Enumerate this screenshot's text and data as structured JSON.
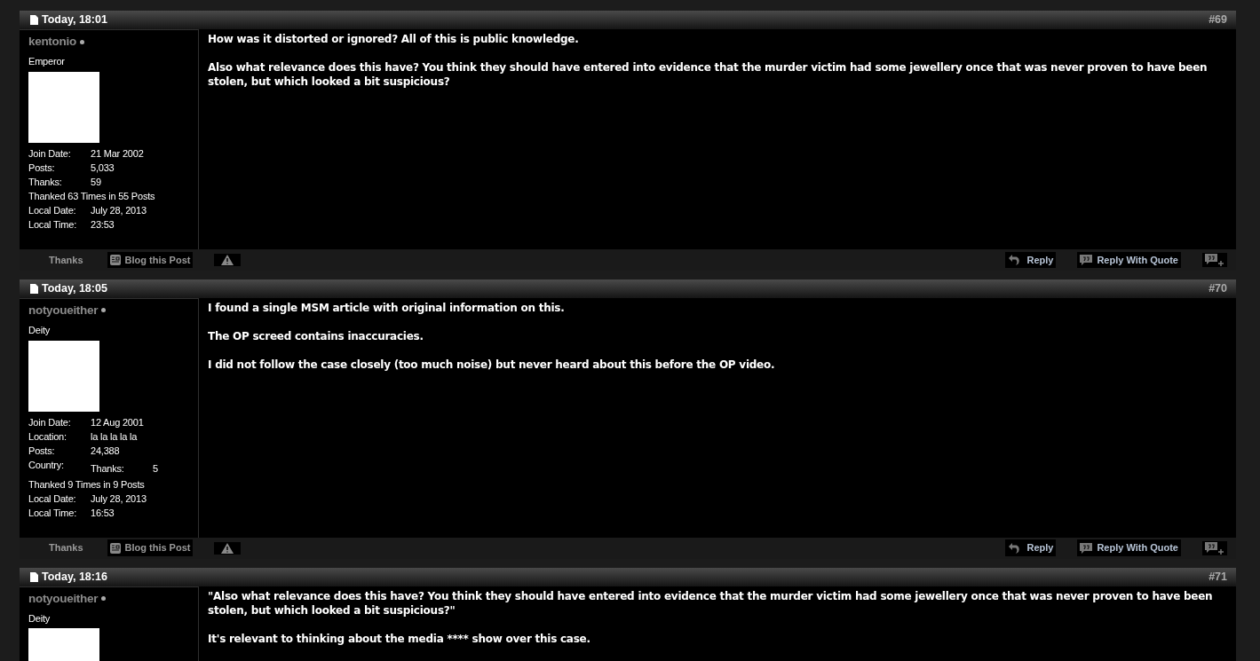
{
  "posts": [
    {
      "date": "Today, 18:01",
      "number": "#69",
      "user": {
        "name": "kentonio",
        "rank": "Emperor",
        "fields": [
          {
            "kind": "pair",
            "label": "Join Date:",
            "value": "21 Mar 2002"
          },
          {
            "kind": "pair",
            "label": "Posts:",
            "value": "5,033"
          },
          {
            "kind": "pair",
            "label": "Thanks:",
            "value": "59"
          },
          {
            "kind": "line",
            "label": "Thanked 63 Times in 55 Posts"
          },
          {
            "kind": "pair",
            "label": "Local Date:",
            "value": "July 28, 2013"
          },
          {
            "kind": "pair",
            "label": "Local Time:",
            "value": "23:53"
          }
        ]
      },
      "paragraphs": [
        "How was it distorted or ignored? All of this is public knowledge.",
        "Also what relevance does this have? You think they should have entered into evidence that the murder victim had some jewellery once that was never proven to have been stolen, but which looked a bit suspicious?"
      ],
      "actions": [
        {
          "kind": "thanks",
          "label": "Thanks"
        },
        {
          "kind": "blog",
          "label": "Blog this Post"
        },
        {
          "kind": "report"
        },
        {
          "kind": "reply",
          "label": "Reply"
        },
        {
          "kind": "quote",
          "label": "Reply With Quote"
        },
        {
          "kind": "multiquote"
        }
      ]
    },
    {
      "date": "Today, 18:05",
      "number": "#70",
      "user": {
        "name": "notyoueither",
        "rank": "Deity",
        "fields": [
          {
            "kind": "pair",
            "label": "Join Date:",
            "value": "12 Aug 2001"
          },
          {
            "kind": "pair",
            "label": "Location:",
            "value": "la la la la la"
          },
          {
            "kind": "pair",
            "label": "Posts:",
            "value": "24,388"
          },
          {
            "kind": "double",
            "label": "Country:",
            "sublabel": "Thanks:",
            "value": "5"
          },
          {
            "kind": "line",
            "label": "Thanked 9 Times in 9 Posts"
          },
          {
            "kind": "pair",
            "label": "Local Date:",
            "value": "July 28, 2013"
          },
          {
            "kind": "pair",
            "label": "Local Time:",
            "value": "16:53"
          }
        ]
      },
      "paragraphs": [
        "I found a single MSM article with original information on this.",
        "The OP screed contains inaccuracies.",
        "I did not follow the case closely (too much noise) but never heard about this before the OP video."
      ],
      "actions": [
        {
          "kind": "thanks",
          "label": "Thanks"
        },
        {
          "kind": "blog",
          "label": "Blog this Post"
        },
        {
          "kind": "report"
        },
        {
          "kind": "reply",
          "label": "Reply"
        },
        {
          "kind": "quote",
          "label": "Reply With Quote"
        },
        {
          "kind": "multiquote"
        }
      ]
    },
    {
      "date": "Today, 18:16",
      "number": "#71",
      "user": {
        "name": "notyoueither",
        "rank": "Deity"
      },
      "paragraphs": [
        "\"Also what relevance does this have? You think they should have entered into evidence that the murder victim had some jewellery once that was never proven to have been stolen, but which looked a bit suspicious?\"",
        "It's relevant to thinking about the media **** show over this case."
      ]
    }
  ]
}
